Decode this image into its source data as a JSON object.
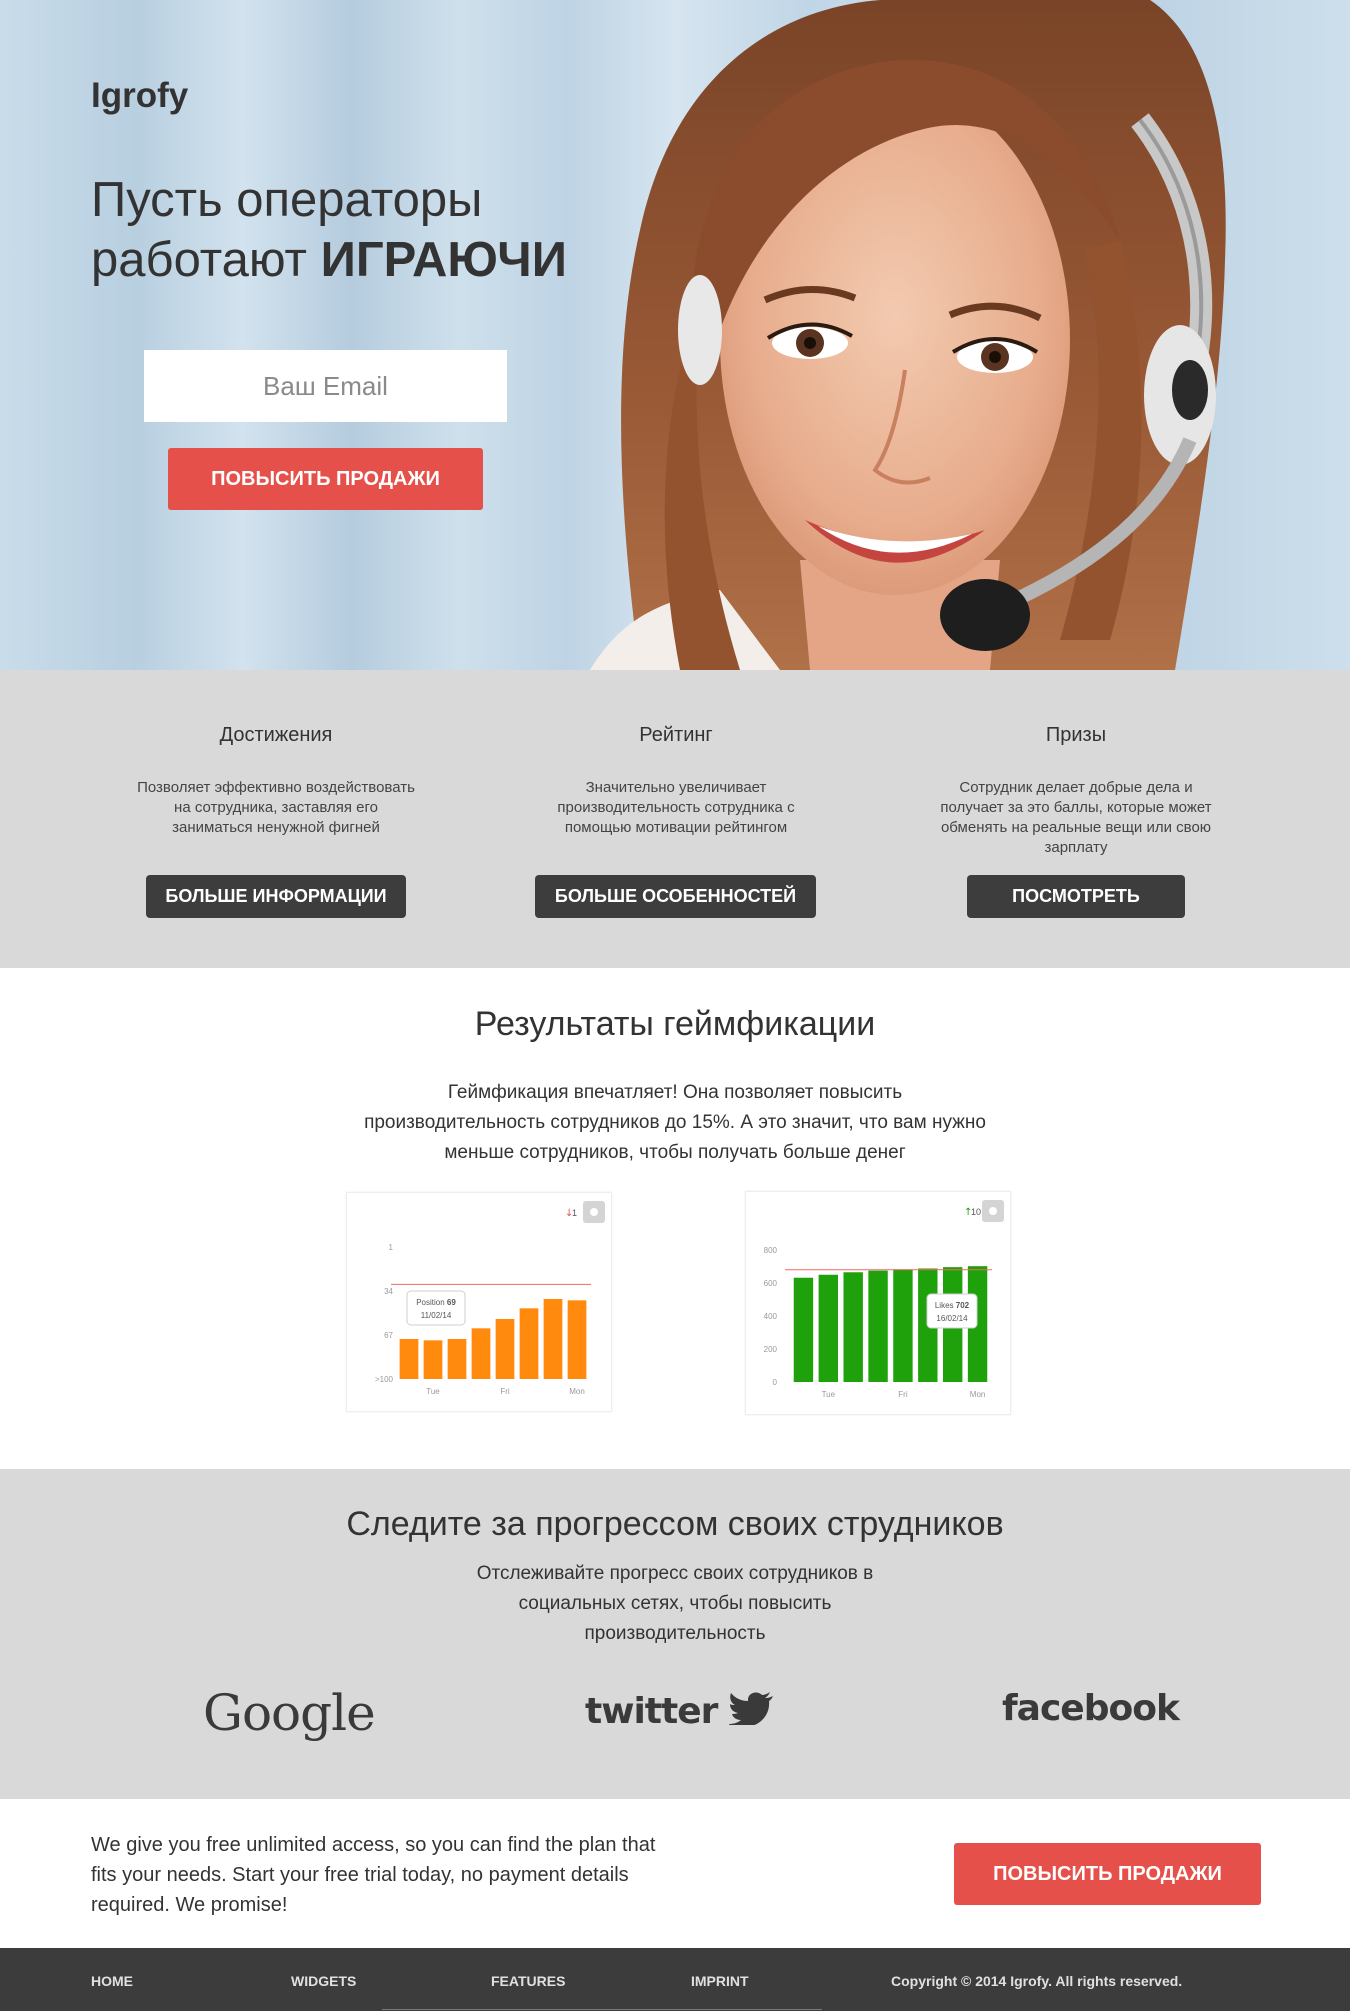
{
  "brand": {
    "name": "Igrofy"
  },
  "hero": {
    "title_line1": "Пусть операторы",
    "title_line2_prefix": "работают ",
    "title_line2_strong": "ИГРАЮЧИ",
    "email_placeholder": "Ваш Email",
    "cta_label": "ПОВЫСИТЬ ПРОДАЖИ"
  },
  "features": [
    {
      "title": "Достижения",
      "text": "Позволяет эффективно воздействовать на сотрудника, заставляя его заниматься ненужной фигней",
      "button": "БОЛЬШЕ ИНФОРМАЦИИ"
    },
    {
      "title": "Рейтинг",
      "text": "Значительно увеличивает производительность сотрудника с помощью мотивации рейтингом",
      "button": "БОЛЬШЕ ОСОБЕННОСТЕЙ"
    },
    {
      "title": "Призы",
      "text": "Сотрудник делает добрые дела и получает за это баллы, которые может обменять на реальные вещи или свою зарплату",
      "button": "ПОСМОТРЕТЬ"
    }
  ],
  "results": {
    "title": "Результаты геймфикации",
    "text": "Геймфикация впечатляет! Она позволяет повысить производительность сотрудников до 15%. А это значит, что вам нужно меньше сотрудников, чтобы получать больше денег"
  },
  "chart_data": [
    {
      "type": "bar",
      "color": "#ff8a0d",
      "badge": "1",
      "badge_direction": "down",
      "badge_color": "#e5504a",
      "y_tick_labels": [
        "1",
        "34",
        "67",
        ">100"
      ],
      "x_tick_labels": [
        "Tue",
        "Fri",
        "Mon"
      ],
      "values": [
        70,
        71,
        70,
        62,
        55,
        47,
        40,
        41
      ],
      "y_reversed": true,
      "ylim": [
        1,
        100
      ],
      "reference_line": 29,
      "tooltip": {
        "label": "Position",
        "value": "69",
        "date": "11/02/14"
      }
    },
    {
      "type": "bar",
      "color": "#1ea10a",
      "badge": "10",
      "badge_direction": "up",
      "badge_color": "#1ea10a",
      "y_tick_labels": [
        "800",
        "600",
        "400",
        "200",
        "0"
      ],
      "x_tick_labels": [
        "Tue",
        "Fri",
        "Mon"
      ],
      "values": [
        632,
        650,
        665,
        675,
        683,
        688,
        696,
        702
      ],
      "ylim": [
        0,
        800
      ],
      "reference_line": 680,
      "tooltip": {
        "label": "Likes",
        "value": "702",
        "date": "16/02/14"
      }
    }
  ],
  "social": {
    "title": "Следите за прогрессом своих струдников",
    "text": "Отслеживайте прогресс своих сотрудников в социальных сетях, чтобы повысить производительность",
    "brands": [
      "Google",
      "twitter",
      "facebook"
    ]
  },
  "promo": {
    "text": "We give you free unlimited access, so you can find the plan that fits your needs. Start your free trial today, no payment details required. We promise!",
    "cta_label": "ПОВЫСИТЬ ПРОДАЖИ"
  },
  "footer": {
    "links": [
      "HOME",
      "WIDGETS",
      "FEATURES",
      "IMPRINT"
    ],
    "copyright": "Copyright © 2014 Igrofy. All rights reserved."
  }
}
